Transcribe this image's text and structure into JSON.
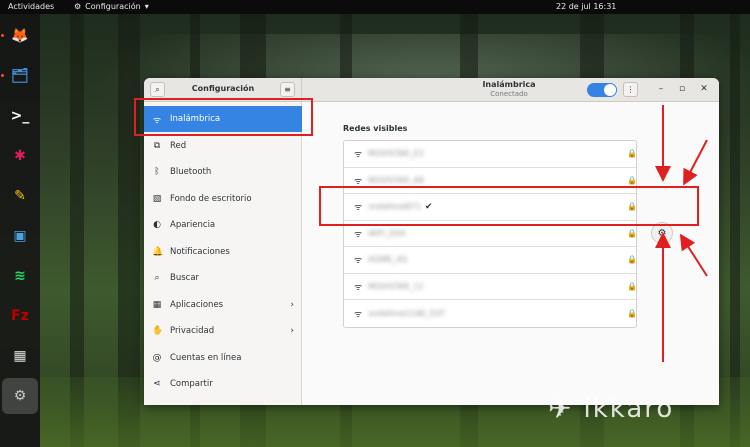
{
  "topbar": {
    "activities": "Actividades",
    "app_menu": "Configuración",
    "clock": "22 de jul  16:31"
  },
  "dock": [
    {
      "name": "firefox",
      "glyph": "🦊",
      "color": "#e66000"
    },
    {
      "name": "files",
      "glyph": "🗂",
      "color": "#4a90d9"
    },
    {
      "name": "terminal",
      "glyph": ">_",
      "color": "#ffffff"
    },
    {
      "name": "slack",
      "glyph": "✱",
      "color": "#e01e5a"
    },
    {
      "name": "text-editor",
      "glyph": "✎",
      "color": "#f5c211"
    },
    {
      "name": "screenshot",
      "glyph": "▣",
      "color": "#4aa3df"
    },
    {
      "name": "spotify",
      "glyph": "≋",
      "color": "#1ed760"
    },
    {
      "name": "filezilla",
      "glyph": "Fz",
      "color": "#bf0000"
    },
    {
      "name": "calculator",
      "glyph": "▦",
      "color": "#dddddd"
    },
    {
      "name": "settings",
      "glyph": "⚙",
      "color": "#cccccc"
    }
  ],
  "window": {
    "sidebar_title": "Configuración",
    "main_title": "Inalámbrica",
    "main_subtitle": "Conectado",
    "toggle_on": true
  },
  "sidebar": {
    "items": [
      {
        "label": "Inalámbrica",
        "icon": "wifi-icon",
        "glyph": "ᯤ",
        "chevron": false
      },
      {
        "label": "Red",
        "icon": "network-icon",
        "glyph": "⧉",
        "chevron": false
      },
      {
        "label": "Bluetooth",
        "icon": "bluetooth-icon",
        "glyph": "ᛒ",
        "chevron": false
      },
      {
        "label": "Fondo de escritorio",
        "icon": "wallpaper-icon",
        "glyph": "▧",
        "chevron": false
      },
      {
        "label": "Apariencia",
        "icon": "appearance-icon",
        "glyph": "◐",
        "chevron": false
      },
      {
        "label": "Notificaciones",
        "icon": "bell-icon",
        "glyph": "🔔",
        "chevron": false
      },
      {
        "label": "Buscar",
        "icon": "search-icon",
        "glyph": "⌕",
        "chevron": false
      },
      {
        "label": "Aplicaciones",
        "icon": "apps-icon",
        "glyph": "▦",
        "chevron": true
      },
      {
        "label": "Privacidad",
        "icon": "privacy-icon",
        "glyph": "✋",
        "chevron": true
      },
      {
        "label": "Cuentas en línea",
        "icon": "online-accounts-icon",
        "glyph": "@",
        "chevron": false
      },
      {
        "label": "Compartir",
        "icon": "share-icon",
        "glyph": "⋖",
        "chevron": false
      }
    ]
  },
  "main": {
    "section_title": "Redes visibles",
    "networks": [
      {
        "name": "MOVISTAR_E3",
        "connected": false,
        "blurred": true
      },
      {
        "name": "MOVISTAR_A8",
        "connected": false,
        "blurred": true
      },
      {
        "name": "vodafoneB71",
        "connected": true,
        "blurred": true
      },
      {
        "name": "WIFI_D50",
        "connected": false,
        "blurred": true
      },
      {
        "name": "HOME_4G",
        "connected": false,
        "blurred": true
      },
      {
        "name": "MOVISTAR_12",
        "connected": false,
        "blurred": true
      },
      {
        "name": "vodafone11AE_EXT",
        "suffix": "11AE_EXT",
        "connected": false,
        "blurred": true
      }
    ]
  },
  "watermark": "ikkaro",
  "colors": {
    "accent": "#3584e4",
    "annotation": "#e02020"
  }
}
